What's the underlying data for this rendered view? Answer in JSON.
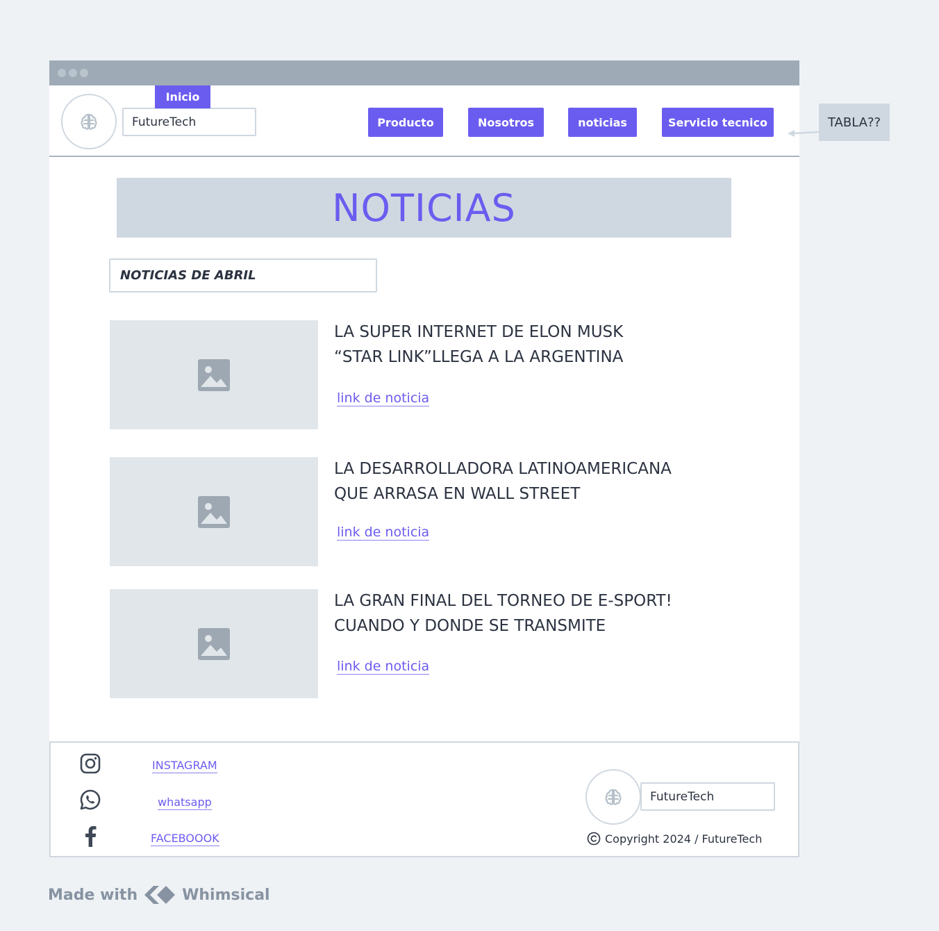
{
  "header": {
    "brand": "FutureTech",
    "inicio_label": "Inicio",
    "nav": [
      "Producto",
      "Nosotros",
      "noticias",
      "Servicio tecnico"
    ]
  },
  "main": {
    "banner_title": "NOTICIAS",
    "section_title": "NOTICIAS DE ABRIL",
    "news": [
      {
        "line1": "LA SUPER INTERNET DE ELON MUSK",
        "line2": "“STAR LINK”LLEGA A LA ARGENTINA",
        "link": "link de noticia"
      },
      {
        "line1": "LA DESARROLLADORA LATINOAMERICANA",
        "line2": "QUE ARRASA EN WALL STREET",
        "link": "link de noticia"
      },
      {
        "line1": "LA GRAN FINAL DEL TORNEO DE E-SPORT!",
        "line2": "CUANDO Y DONDE SE TRANSMITE",
        "link": "link de noticia"
      }
    ]
  },
  "footer": {
    "social": [
      {
        "icon": "instagram-icon",
        "label": "INSTAGRAM"
      },
      {
        "icon": "whatsapp-icon",
        "label": "whatsapp"
      },
      {
        "icon": "facebook-icon",
        "label": "FACEBOOOK"
      }
    ],
    "brand": "FutureTech",
    "copyright": "Copyright 2024 / FutureTech"
  },
  "annotation": {
    "note": "TABLA??"
  },
  "watermark": {
    "made_with": "Made with",
    "brand": "Whimsical"
  },
  "colors": {
    "accent": "#6b5cf0",
    "titlebar": "#9eabb7",
    "placeholder": "#e1e6ea",
    "banner": "#cfd8e0"
  }
}
